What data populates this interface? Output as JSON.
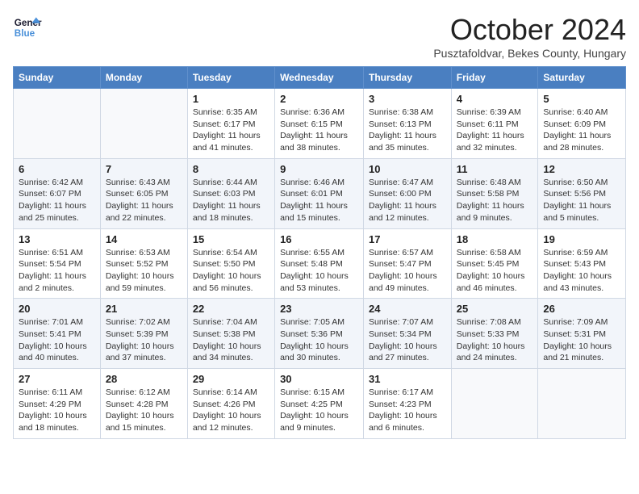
{
  "header": {
    "logo_line1": "General",
    "logo_line2": "Blue",
    "month": "October 2024",
    "location": "Pusztafoldvar, Bekes County, Hungary"
  },
  "days_of_week": [
    "Sunday",
    "Monday",
    "Tuesday",
    "Wednesday",
    "Thursday",
    "Friday",
    "Saturday"
  ],
  "weeks": [
    [
      {
        "day": "",
        "detail": ""
      },
      {
        "day": "",
        "detail": ""
      },
      {
        "day": "1",
        "detail": "Sunrise: 6:35 AM\nSunset: 6:17 PM\nDaylight: 11 hours and 41 minutes."
      },
      {
        "day": "2",
        "detail": "Sunrise: 6:36 AM\nSunset: 6:15 PM\nDaylight: 11 hours and 38 minutes."
      },
      {
        "day": "3",
        "detail": "Sunrise: 6:38 AM\nSunset: 6:13 PM\nDaylight: 11 hours and 35 minutes."
      },
      {
        "day": "4",
        "detail": "Sunrise: 6:39 AM\nSunset: 6:11 PM\nDaylight: 11 hours and 32 minutes."
      },
      {
        "day": "5",
        "detail": "Sunrise: 6:40 AM\nSunset: 6:09 PM\nDaylight: 11 hours and 28 minutes."
      }
    ],
    [
      {
        "day": "6",
        "detail": "Sunrise: 6:42 AM\nSunset: 6:07 PM\nDaylight: 11 hours and 25 minutes."
      },
      {
        "day": "7",
        "detail": "Sunrise: 6:43 AM\nSunset: 6:05 PM\nDaylight: 11 hours and 22 minutes."
      },
      {
        "day": "8",
        "detail": "Sunrise: 6:44 AM\nSunset: 6:03 PM\nDaylight: 11 hours and 18 minutes."
      },
      {
        "day": "9",
        "detail": "Sunrise: 6:46 AM\nSunset: 6:01 PM\nDaylight: 11 hours and 15 minutes."
      },
      {
        "day": "10",
        "detail": "Sunrise: 6:47 AM\nSunset: 6:00 PM\nDaylight: 11 hours and 12 minutes."
      },
      {
        "day": "11",
        "detail": "Sunrise: 6:48 AM\nSunset: 5:58 PM\nDaylight: 11 hours and 9 minutes."
      },
      {
        "day": "12",
        "detail": "Sunrise: 6:50 AM\nSunset: 5:56 PM\nDaylight: 11 hours and 5 minutes."
      }
    ],
    [
      {
        "day": "13",
        "detail": "Sunrise: 6:51 AM\nSunset: 5:54 PM\nDaylight: 11 hours and 2 minutes."
      },
      {
        "day": "14",
        "detail": "Sunrise: 6:53 AM\nSunset: 5:52 PM\nDaylight: 10 hours and 59 minutes."
      },
      {
        "day": "15",
        "detail": "Sunrise: 6:54 AM\nSunset: 5:50 PM\nDaylight: 10 hours and 56 minutes."
      },
      {
        "day": "16",
        "detail": "Sunrise: 6:55 AM\nSunset: 5:48 PM\nDaylight: 10 hours and 53 minutes."
      },
      {
        "day": "17",
        "detail": "Sunrise: 6:57 AM\nSunset: 5:47 PM\nDaylight: 10 hours and 49 minutes."
      },
      {
        "day": "18",
        "detail": "Sunrise: 6:58 AM\nSunset: 5:45 PM\nDaylight: 10 hours and 46 minutes."
      },
      {
        "day": "19",
        "detail": "Sunrise: 6:59 AM\nSunset: 5:43 PM\nDaylight: 10 hours and 43 minutes."
      }
    ],
    [
      {
        "day": "20",
        "detail": "Sunrise: 7:01 AM\nSunset: 5:41 PM\nDaylight: 10 hours and 40 minutes."
      },
      {
        "day": "21",
        "detail": "Sunrise: 7:02 AM\nSunset: 5:39 PM\nDaylight: 10 hours and 37 minutes."
      },
      {
        "day": "22",
        "detail": "Sunrise: 7:04 AM\nSunset: 5:38 PM\nDaylight: 10 hours and 34 minutes."
      },
      {
        "day": "23",
        "detail": "Sunrise: 7:05 AM\nSunset: 5:36 PM\nDaylight: 10 hours and 30 minutes."
      },
      {
        "day": "24",
        "detail": "Sunrise: 7:07 AM\nSunset: 5:34 PM\nDaylight: 10 hours and 27 minutes."
      },
      {
        "day": "25",
        "detail": "Sunrise: 7:08 AM\nSunset: 5:33 PM\nDaylight: 10 hours and 24 minutes."
      },
      {
        "day": "26",
        "detail": "Sunrise: 7:09 AM\nSunset: 5:31 PM\nDaylight: 10 hours and 21 minutes."
      }
    ],
    [
      {
        "day": "27",
        "detail": "Sunrise: 6:11 AM\nSunset: 4:29 PM\nDaylight: 10 hours and 18 minutes."
      },
      {
        "day": "28",
        "detail": "Sunrise: 6:12 AM\nSunset: 4:28 PM\nDaylight: 10 hours and 15 minutes."
      },
      {
        "day": "29",
        "detail": "Sunrise: 6:14 AM\nSunset: 4:26 PM\nDaylight: 10 hours and 12 minutes."
      },
      {
        "day": "30",
        "detail": "Sunrise: 6:15 AM\nSunset: 4:25 PM\nDaylight: 10 hours and 9 minutes."
      },
      {
        "day": "31",
        "detail": "Sunrise: 6:17 AM\nSunset: 4:23 PM\nDaylight: 10 hours and 6 minutes."
      },
      {
        "day": "",
        "detail": ""
      },
      {
        "day": "",
        "detail": ""
      }
    ]
  ]
}
